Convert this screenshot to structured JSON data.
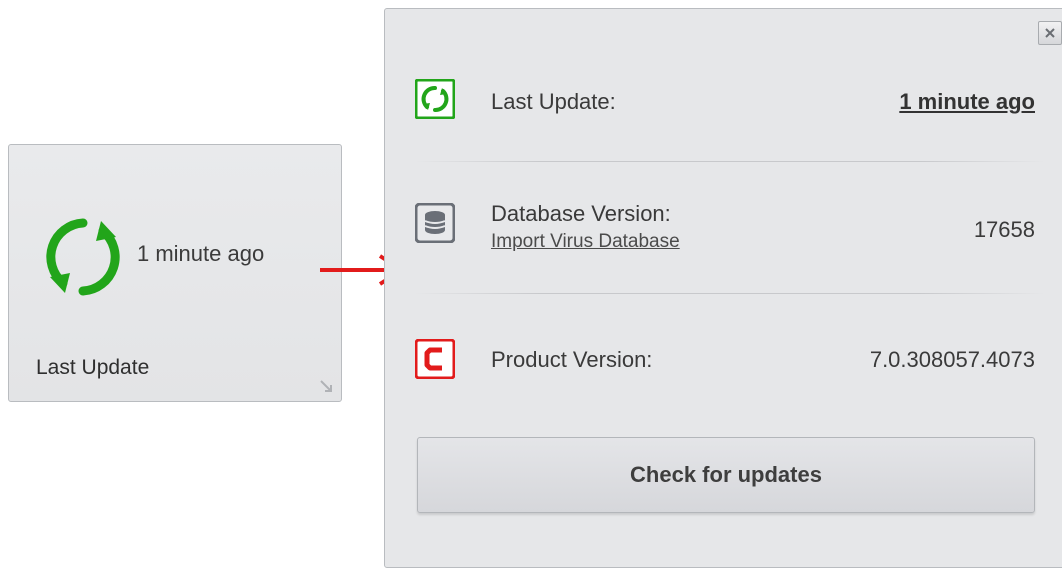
{
  "tile": {
    "time_text": "1 minute ago",
    "label": "Last Update"
  },
  "panel": {
    "last_update": {
      "label": "Last Update:",
      "value": "1 minute ago"
    },
    "database": {
      "label": "Database Version:",
      "link": "Import Virus Database",
      "value": "17658"
    },
    "product": {
      "label": "Product Version:",
      "value": "7.0.308057.4073"
    },
    "check_button": "Check for updates"
  },
  "colors": {
    "green": "#22a51a",
    "red": "#e21b1b",
    "grey_icon": "#6a6f77"
  },
  "icons": [
    "refresh-icon",
    "resize-corner-icon",
    "red-arrow",
    "close-icon",
    "database-icon",
    "product-logo-icon"
  ]
}
